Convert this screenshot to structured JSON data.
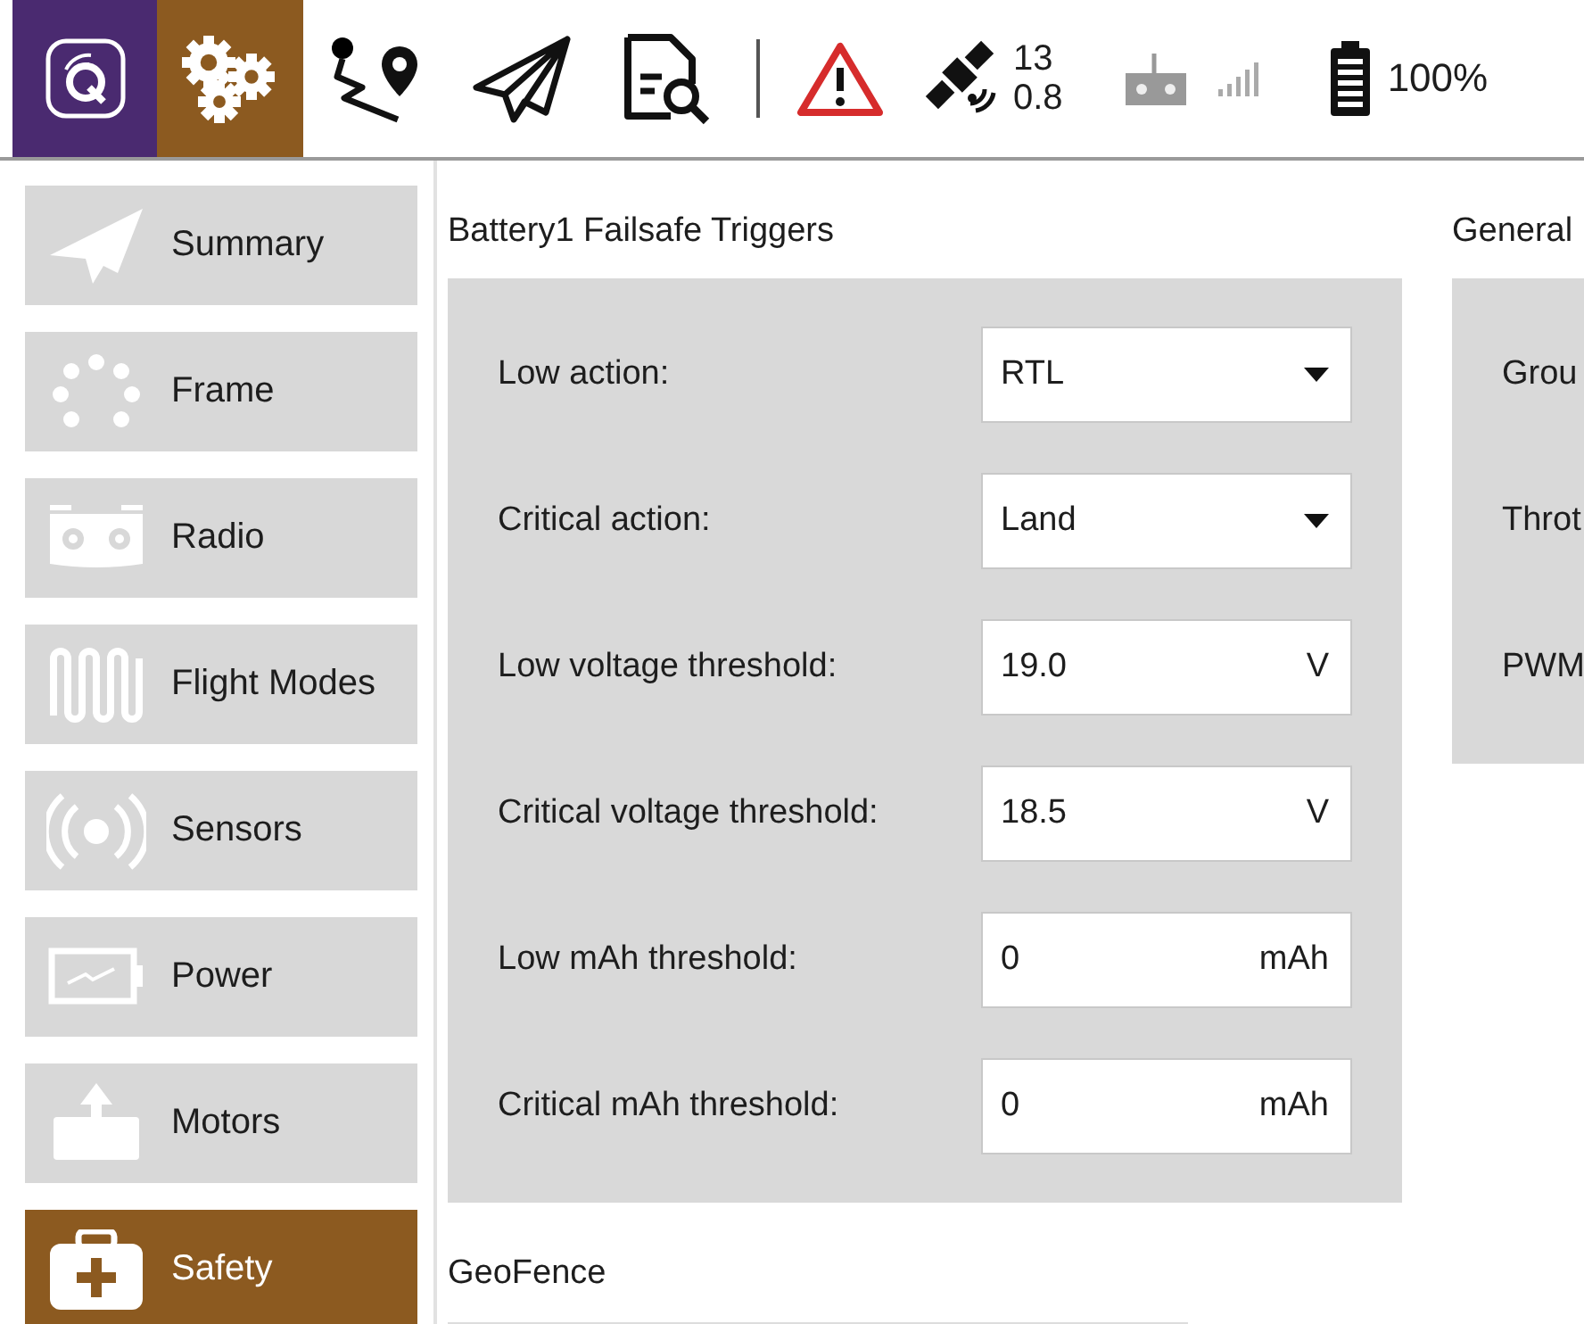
{
  "toolbar": {
    "views": [
      {
        "kind": "app",
        "selected": false
      },
      {
        "kind": "setup",
        "selected": true
      },
      {
        "kind": "plan",
        "selected": false
      },
      {
        "kind": "fly",
        "selected": false
      },
      {
        "kind": "analyze",
        "selected": false
      }
    ],
    "status": {
      "satellites": "13",
      "hdop": "0.8",
      "battery": "100%"
    }
  },
  "sidebar": {
    "items": [
      {
        "kind": "summary",
        "label": "Summary",
        "selected": false
      },
      {
        "kind": "frame",
        "label": "Frame",
        "selected": false
      },
      {
        "kind": "radio",
        "label": "Radio",
        "selected": false
      },
      {
        "kind": "modes",
        "label": "Flight Modes",
        "selected": false
      },
      {
        "kind": "sensors",
        "label": "Sensors",
        "selected": false
      },
      {
        "kind": "power",
        "label": "Power",
        "selected": false
      },
      {
        "kind": "motors",
        "label": "Motors",
        "selected": false
      },
      {
        "kind": "safety",
        "label": "Safety",
        "selected": true
      }
    ]
  },
  "battery_failsafe": {
    "title": "Battery1 Failsafe Triggers",
    "fields": [
      {
        "kind": "dropdown",
        "label": "Low action:",
        "value": "RTL"
      },
      {
        "kind": "dropdown",
        "label": "Critical action:",
        "value": "Land"
      },
      {
        "kind": "number",
        "label": "Low voltage threshold:",
        "value": "19.0",
        "unit": "V"
      },
      {
        "kind": "number",
        "label": "Critical voltage threshold:",
        "value": "18.5",
        "unit": "V"
      },
      {
        "kind": "number",
        "label": "Low mAh threshold:",
        "value": "0",
        "unit": "mAh"
      },
      {
        "kind": "number",
        "label": "Critical mAh threshold:",
        "value": "0",
        "unit": "mAh"
      }
    ]
  },
  "general": {
    "title": "General",
    "labels": [
      "Grou",
      "Throt",
      "PWM"
    ]
  },
  "geofence": {
    "title": "GeoFence"
  }
}
